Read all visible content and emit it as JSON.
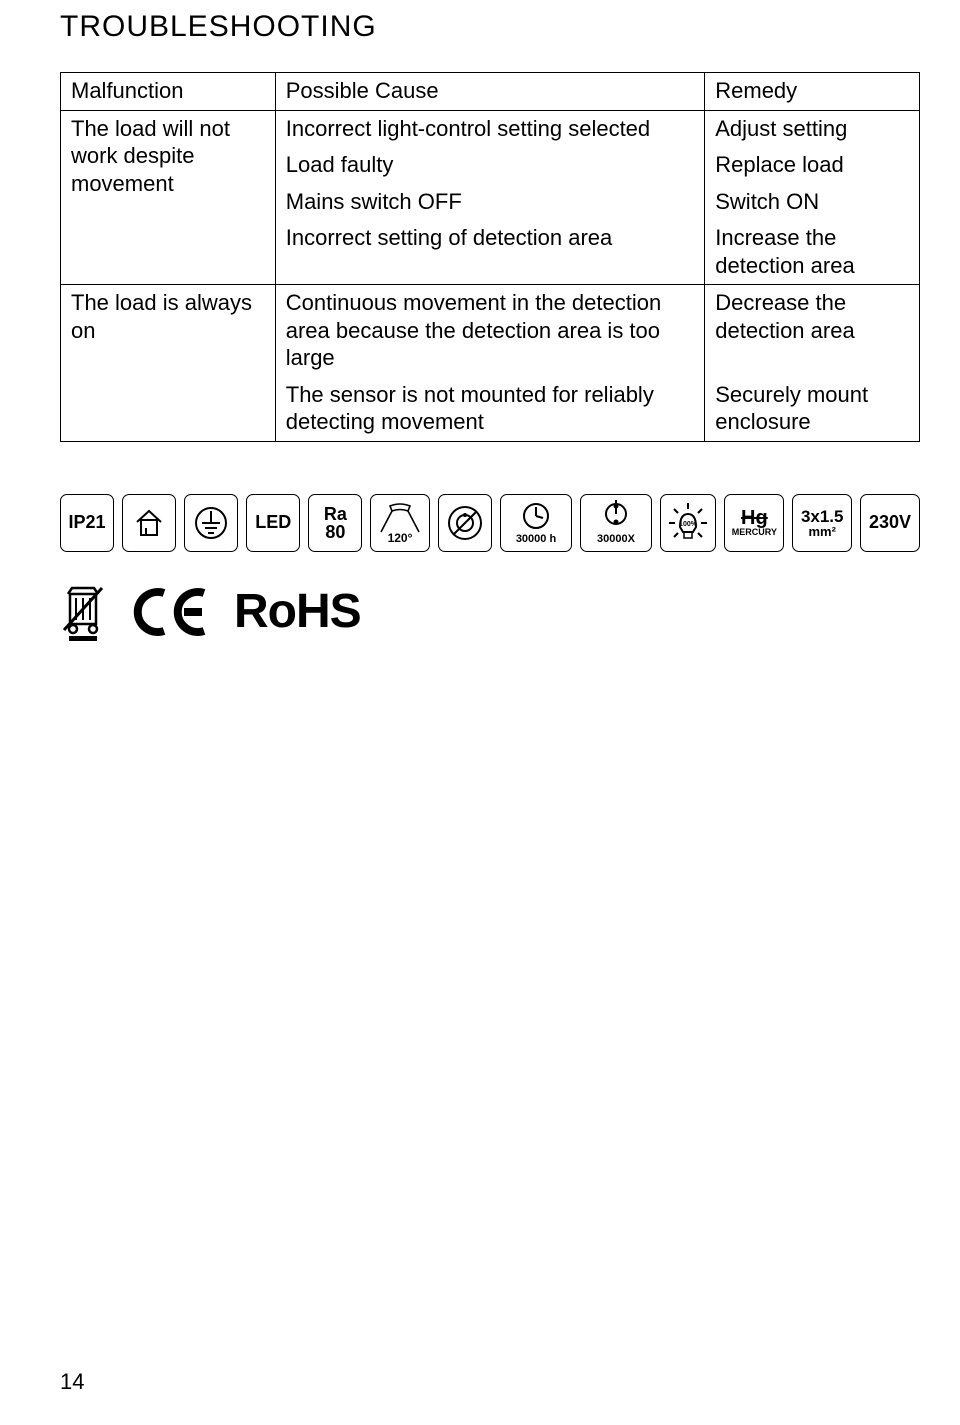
{
  "title": "TROUBLESHOOTING",
  "table": {
    "headers": {
      "c1": "Malfunction",
      "c2": "Possible Cause",
      "c3": "Remedy"
    },
    "group1": {
      "malfunction": "The load will not work despite movement",
      "rows": [
        {
          "cause": "Incorrect light-control setting selected",
          "remedy": "Adjust setting"
        },
        {
          "cause": "Load faulty",
          "remedy": "Replace load"
        },
        {
          "cause": "Mains switch OFF",
          "remedy": "Switch ON"
        },
        {
          "cause": "Incorrect setting of detection area",
          "remedy": "Increase the detection area"
        }
      ]
    },
    "group2": {
      "malfunction": "The load is always on",
      "rows": [
        {
          "cause": "Continuous movement in the detection area because the detection area is too large",
          "remedy": "Decrease the detection area"
        },
        {
          "cause": "The sensor is not mounted for reliably detecting movement",
          "remedy": "Securely mount enclosure"
        }
      ]
    }
  },
  "stamps": {
    "ip": "IP21",
    "led": "LED",
    "ra_top": "Ra",
    "ra_bottom": "80",
    "angle": "120°",
    "hours": "30000 h",
    "cycles": "30000X",
    "bulb_pct": "100%",
    "hg_top": "Hg",
    "hg_bottom": "MERCURY",
    "dim_top": "3x1.5",
    "dim_bottom": "mm²",
    "voltage": "230V"
  },
  "cert": {
    "rohs": "RoHS"
  },
  "page_number": "14"
}
